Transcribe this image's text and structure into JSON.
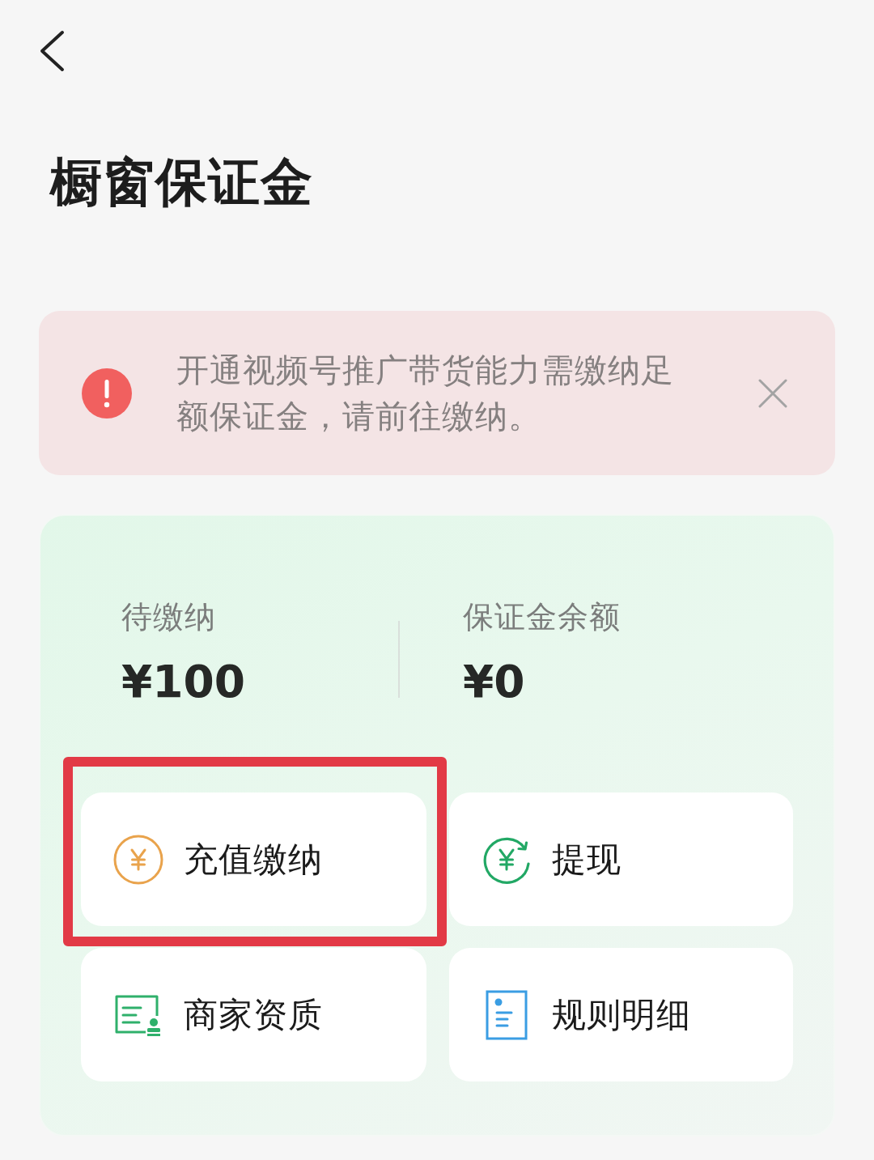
{
  "header": {
    "title": "橱窗保证金"
  },
  "alert": {
    "message": "开通视频号推广带货能力需缴纳足额保证金，请前往缴纳。"
  },
  "balance": {
    "stats": [
      {
        "label": "待缴纳",
        "amount": "¥100"
      },
      {
        "label": "保证金余额",
        "amount": "¥0"
      }
    ],
    "actions": [
      {
        "kind": "deposit",
        "label": "充值缴纳",
        "highlighted": true
      },
      {
        "kind": "withdraw",
        "label": "提现",
        "highlighted": false
      },
      {
        "kind": "qualification",
        "label": "商家资质",
        "highlighted": false
      },
      {
        "kind": "rules",
        "label": "规则明细",
        "highlighted": false
      }
    ]
  }
}
